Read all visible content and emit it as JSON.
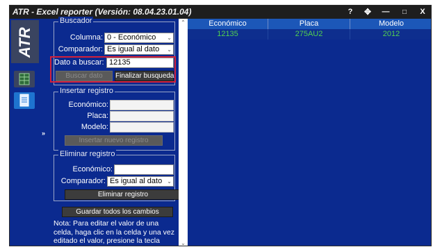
{
  "window": {
    "title": "ATR - Excel reporter (Versión: 08.04.23.01.04)",
    "controls": {
      "help": "?",
      "move": "✥",
      "minimize": "—",
      "maximize": "□",
      "close": "X"
    }
  },
  "sidebar": {
    "logo": "ATR",
    "expand_glyph": "»",
    "items": [
      {
        "icon": "excel-sheet-icon",
        "color": "#2e6b3a"
      },
      {
        "icon": "document-icon",
        "color": "#1e74d0"
      }
    ]
  },
  "buscador": {
    "title": "Buscador",
    "columna_label": "Columna:",
    "columna_value": "0 - Económico",
    "comparador_label": "Comparador:",
    "comparador_value": "Es igual al dato",
    "dato_label": "Dato a buscar:",
    "dato_value": "12135",
    "buscar_button": "Buscar dato",
    "finalizar_button": "Finalizar busqueda"
  },
  "insertar": {
    "title": "Insertar registro",
    "economico_label": "Económico:",
    "economico_value": "",
    "placa_label": "Placa:",
    "placa_value": "",
    "modelo_label": "Modelo:",
    "modelo_value": "",
    "insertar_button": "Insertar nuevo registro"
  },
  "eliminar": {
    "title": "Eliminar registro",
    "economico_label": "Económico:",
    "economico_value": "",
    "comparador_label": "Comparador:",
    "comparador_value": "Es igual al dato",
    "eliminar_button": "Eliminar registro"
  },
  "guardar_button": "Guardar todos los cambios",
  "note": "Nota: Para editar el valor de una celda, haga clic en la celda y una vez editado el valor, presione la tecla 'Enter' para finalizar.",
  "grid": {
    "columns": [
      "Económico",
      "Placa",
      "Modelo"
    ],
    "rows": [
      [
        "12135",
        "275AU2",
        "2012"
      ]
    ]
  },
  "colors": {
    "background": "#0b2a8f",
    "header": "#1c57b8",
    "cell_text": "#52d04f",
    "highlight": "#d4213a"
  }
}
